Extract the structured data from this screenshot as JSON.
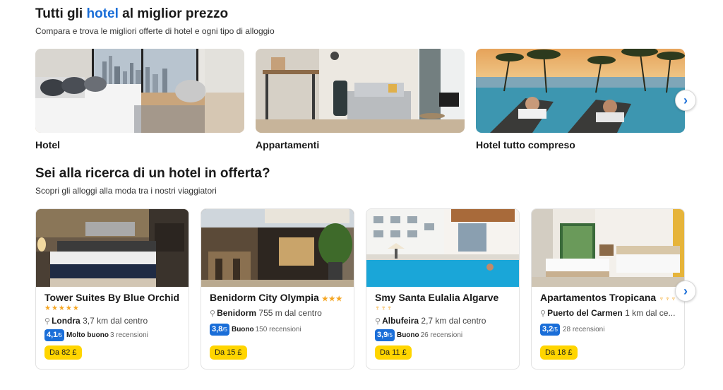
{
  "section1": {
    "title_pre": "Tutti gli ",
    "title_hl": "hotel",
    "title_post": " al miglior prezzo",
    "subtitle": "Compara e trova le migliori offerte di hotel e ogni tipo di alloggio",
    "categories": [
      {
        "label": "Hotel"
      },
      {
        "label": "Appartamenti"
      },
      {
        "label": "Hotel tutto compreso"
      }
    ],
    "next_icon": "chevron-right-icon"
  },
  "section2": {
    "title": "Sei alla ricerca di un hotel in offerta?",
    "subtitle": "Scopri gli alloggi alla moda tra i nostri viaggiatori",
    "hotels": [
      {
        "name": "Tower Suites By Blue Orchid",
        "stars": "★★★★★",
        "city": "Londra",
        "distance": " 3,7 km dal centro",
        "score": "4,1",
        "score_max": "/5",
        "rating_word": "Molto buono",
        "reviews": "3 recensioni",
        "price": "Da 82 £"
      },
      {
        "name": "Benidorm City Olympia",
        "stars": "★★★",
        "city": "Benidorm",
        "distance": " 755 m dal centro",
        "score": "3,8",
        "score_max": "/5",
        "rating_word": "Buono",
        "reviews": "150 recensioni",
        "price": "Da 15 £"
      },
      {
        "name": "Smy Santa Eulalia Algarve",
        "stars": "♆♆♆",
        "city": "Albufeira",
        "distance": " 2,7 km dal centro",
        "score": "3,9",
        "score_max": "/5",
        "rating_word": "Buono",
        "reviews": "26 recensioni",
        "price": "Da 11 £"
      },
      {
        "name": "Apartamentos Tropicana",
        "stars": "♆♆♆",
        "city": "Puerto del Carmen",
        "distance": " 1 km dal ce...",
        "score": "3,2",
        "score_max": "/5",
        "rating_word": "",
        "reviews": "28 recensioni",
        "price": "Da 18 £"
      }
    ],
    "next_icon": "chevron-right-icon"
  },
  "colors": {
    "accent": "#1a6ed8",
    "price_badge": "#ffd500",
    "stars": "#f5a623"
  }
}
